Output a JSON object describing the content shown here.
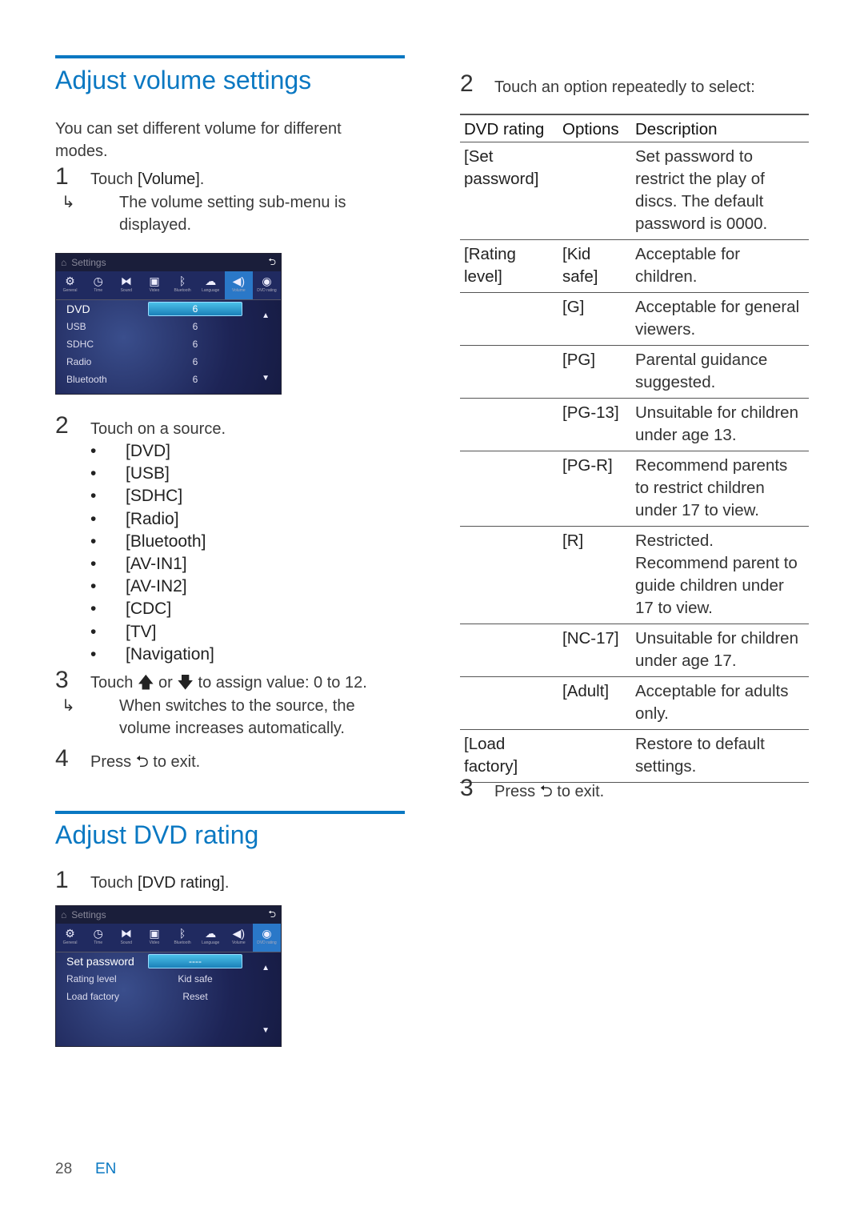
{
  "volume": {
    "title": "Adjust volume settings",
    "intro": "You can set different volume for different modes.",
    "step1": {
      "num": "1",
      "pre": "Touch ",
      "bold": "[Volume]",
      "post": ".",
      "result": "The volume setting sub-menu is displayed."
    },
    "screen": {
      "header": "Settings",
      "tabs": [
        {
          "icon": "⚙",
          "label": "General"
        },
        {
          "icon": "◷",
          "label": "Time"
        },
        {
          "icon": "⧓",
          "label": "Sound"
        },
        {
          "icon": "▣",
          "label": "Video"
        },
        {
          "icon": "ᛒ",
          "label": "Bluetooth"
        },
        {
          "icon": "☁",
          "label": "Language"
        },
        {
          "icon": "◀)",
          "label": "Volume"
        },
        {
          "icon": "◉",
          "label": "DVD rating"
        }
      ],
      "active_tab": 6,
      "rows": [
        {
          "label": "DVD",
          "value": "6"
        },
        {
          "label": "USB",
          "value": "6"
        },
        {
          "label": "SDHC",
          "value": "6"
        },
        {
          "label": "Radio",
          "value": "6"
        },
        {
          "label": "Bluetooth",
          "value": "6"
        }
      ]
    },
    "step2": {
      "num": "2",
      "text": "Touch on a source.",
      "sources": [
        "[DVD]",
        "[USB]",
        "[SDHC]",
        "[Radio]",
        "[Bluetooth]",
        "[AV-IN1]",
        "[AV-IN2]",
        "[CDC]",
        "[TV]",
        "[Navigation]"
      ]
    },
    "step3": {
      "num": "3",
      "a": "Touch ",
      "up": "🡅",
      "b": " or ",
      "down": "🡇",
      "c": " to assign value: 0 to 12.",
      "result": "When switches to the source, the volume increases automatically."
    },
    "step4": {
      "num": "4",
      "a": "Press ",
      "icon": "⮌",
      "b": " to exit."
    }
  },
  "dvd": {
    "title": "Adjust DVD rating",
    "step1": {
      "num": "1",
      "pre": "Touch ",
      "bold": "[DVD rating]",
      "post": "."
    },
    "screen": {
      "header": "Settings",
      "active_tab": 7,
      "rows": [
        {
          "label": "Set password",
          "value": "----"
        },
        {
          "label": "Rating level",
          "value": "Kid safe"
        },
        {
          "label": "Load factory",
          "value": "Reset"
        }
      ]
    },
    "step2": {
      "num": "2",
      "text": "Touch an option repeatedly to select:"
    },
    "table": {
      "headers": [
        "DVD rating",
        "Options",
        "Description"
      ],
      "rows": [
        [
          "[Set password]",
          "",
          "Set password to restrict the play of discs. The default password is 0000."
        ],
        [
          "[Rating level]",
          "[Kid safe]",
          "Acceptable for children."
        ],
        [
          "",
          "[G]",
          "Acceptable for general viewers."
        ],
        [
          "",
          "[PG]",
          "Parental guidance suggested."
        ],
        [
          "",
          "[PG-13]",
          "Unsuitable for children under age 13."
        ],
        [
          "",
          "[PG-R]",
          "Recommend parents to restrict children under 17 to view."
        ],
        [
          "",
          "[R]",
          "Restricted. Recommend parent to guide children under 17 to view."
        ],
        [
          "",
          "[NC-17]",
          "Unsuitable for children under age 17."
        ],
        [
          "",
          "[Adult]",
          "Acceptable for adults only."
        ],
        [
          "[Load factory]",
          "",
          "Restore to default settings."
        ]
      ]
    },
    "step3": {
      "num": "3",
      "a": "Press ",
      "icon": "⮌",
      "b": " to exit."
    }
  },
  "footer": {
    "page": "28",
    "lang": "EN"
  },
  "colors": {
    "accent": "#0a78c2"
  }
}
